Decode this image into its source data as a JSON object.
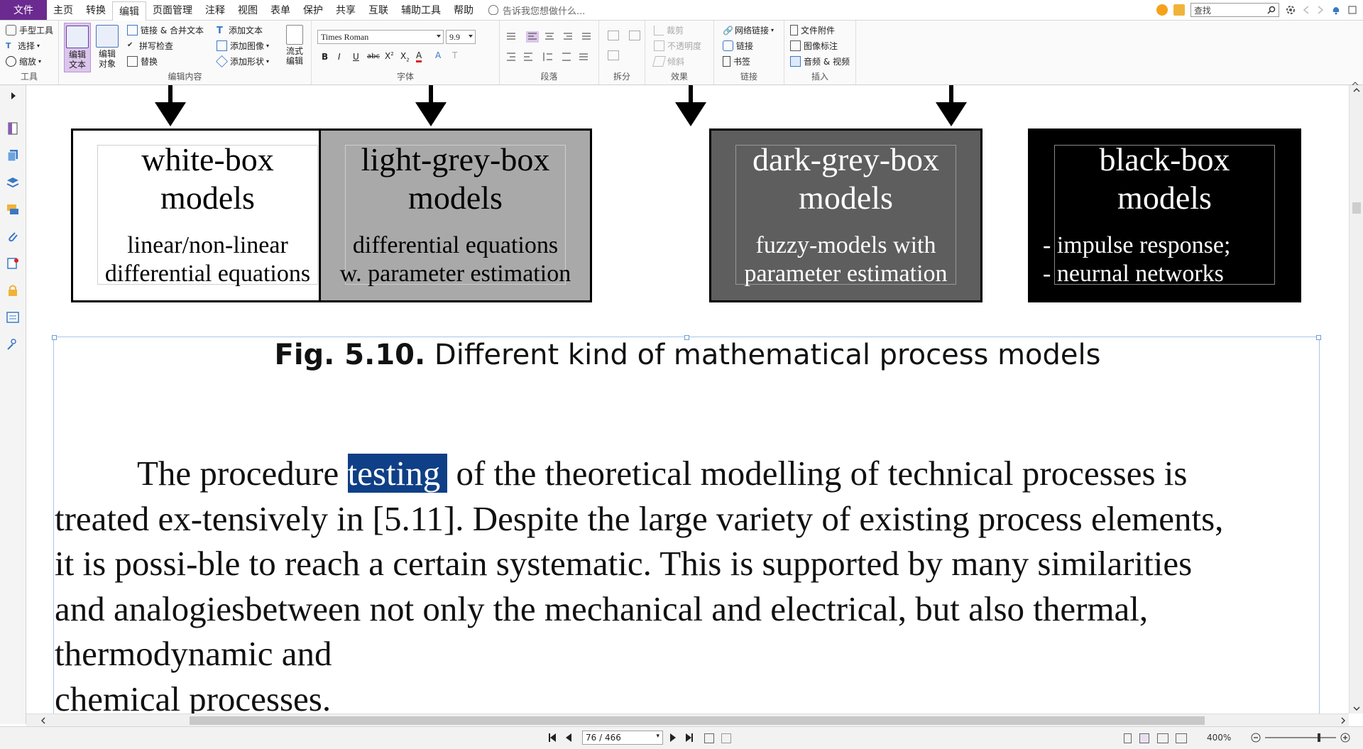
{
  "menu": {
    "file": "文件",
    "items": [
      "主页",
      "转换",
      "编辑",
      "页面管理",
      "注释",
      "视图",
      "表单",
      "保护",
      "共享",
      "互联",
      "辅助工具",
      "帮助"
    ],
    "active_index": 2,
    "tell_me": "告诉我您想做什么...",
    "search_placeholder": "查找"
  },
  "ribbon": {
    "tools": {
      "hand": "手型工具",
      "select": "选择",
      "zoom": "缩放",
      "label": "工具"
    },
    "edit_content": {
      "edit_text": "编辑文本",
      "edit_object": "编辑对象",
      "link_merge": "链接 & 合并文本",
      "spell_check": "拼写检查",
      "replace": "替换",
      "add_text": "添加文本",
      "add_image": "添加图像",
      "add_shape": "添加形状",
      "flow_edit": "流式编辑",
      "label": "编辑内容"
    },
    "font": {
      "family": "Times Roman",
      "size": "9.9",
      "label": "字体"
    },
    "paragraph": {
      "label": "段落"
    },
    "split": {
      "label": "拆分"
    },
    "effects": {
      "crop": "裁剪",
      "opacity": "不透明度",
      "skew": "倾斜",
      "label": "效果"
    },
    "links": {
      "web_link": "网络链接",
      "link": "链接",
      "bookmark": "书签",
      "label": "链接"
    },
    "insert": {
      "file_attachment": "文件附件",
      "image_annotation": "图像标注",
      "audio_video": "音频 & 视频",
      "label": "插入"
    }
  },
  "document": {
    "boxes": [
      {
        "title": "white-box\nmodels",
        "desc": "linear/non-linear\ndifferential equations",
        "bg": "#ffffff",
        "fg": "#000000"
      },
      {
        "title": "light-grey-box\nmodels",
        "desc": "differential equations\nw. parameter estimation",
        "bg": "#a9a9a9",
        "fg": "#000000"
      },
      {
        "title": "dark-grey-box\nmodels",
        "desc": "fuzzy-models with\nparameter estimation",
        "bg": "#5e5e5e",
        "fg": "#ffffff"
      },
      {
        "title": "black-box\nmodels",
        "desc": "- impulse response;\n- neurnal networks",
        "bg": "#000000",
        "fg": "#ffffff"
      }
    ],
    "caption_label": "Fig. 5.10.",
    "caption_text": " Different kind of mathematical process models",
    "paragraph": {
      "line1_before": "The procedure ",
      "line1_highlight": "testing",
      "line1_after": " of the theoretical modelling of technical processes is",
      "line2": "treated ex-tensively in [5.11]. Despite the large variety of existing process elements,",
      "line3": "it is possi-ble to reach a certain systematic. This is supported by many similarities",
      "line4": "and analogiesbetween not only the mechanical and electrical, but also thermal,",
      "line5": "thermodynamic and",
      "line6": "chemical processes."
    }
  },
  "statusbar": {
    "page": "76 / 466",
    "zoom": "400%"
  },
  "colors": {
    "accent": "#6b2a8f",
    "highlight": "#0f3f86"
  }
}
